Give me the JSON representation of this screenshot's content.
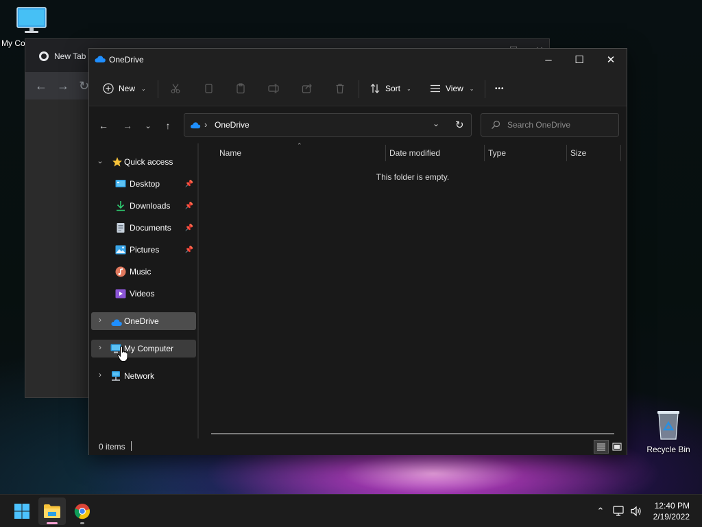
{
  "desktop": {
    "icons": [
      {
        "label": "My Co",
        "icon": "monitor-icon"
      },
      {
        "label": "Recycle Bin",
        "icon": "recycle-bin-icon"
      }
    ]
  },
  "background_window": {
    "tab_title": "New Tab"
  },
  "explorer": {
    "title": "OneDrive",
    "window_controls": {
      "minimize": "─",
      "maximize": "☐",
      "close": "✕"
    },
    "commandbar": {
      "new_label": "New",
      "sort_label": "Sort",
      "view_label": "View",
      "more_label": "•••"
    },
    "address": {
      "separator": "›",
      "location": "OneDrive"
    },
    "search": {
      "placeholder": "Search OneDrive"
    },
    "sidebar": {
      "quick_access": "Quick access",
      "items": [
        {
          "label": "Desktop",
          "icon": "desktop-folder-icon",
          "pinned": true
        },
        {
          "label": "Downloads",
          "icon": "downloads-icon",
          "pinned": true
        },
        {
          "label": "Documents",
          "icon": "documents-icon",
          "pinned": true
        },
        {
          "label": "Pictures",
          "icon": "pictures-icon",
          "pinned": true
        },
        {
          "label": "Music",
          "icon": "music-icon",
          "pinned": false
        },
        {
          "label": "Videos",
          "icon": "videos-icon",
          "pinned": false
        }
      ],
      "onedrive": "OneDrive",
      "my_computer": "My Computer",
      "network": "Network"
    },
    "columns": [
      "Name",
      "Date modified",
      "Type",
      "Size"
    ],
    "empty_message": "This folder is empty.",
    "status": "0 items"
  },
  "taskbar": {
    "time": "12:40 PM",
    "date": "2/19/2022"
  },
  "colors": {
    "accent": "#4cc2ff",
    "onedrive_blue": "#1f8fff",
    "folder_yellow": "#f8c33a",
    "window_bg": "#191919",
    "chrome_bar": "#202020"
  }
}
